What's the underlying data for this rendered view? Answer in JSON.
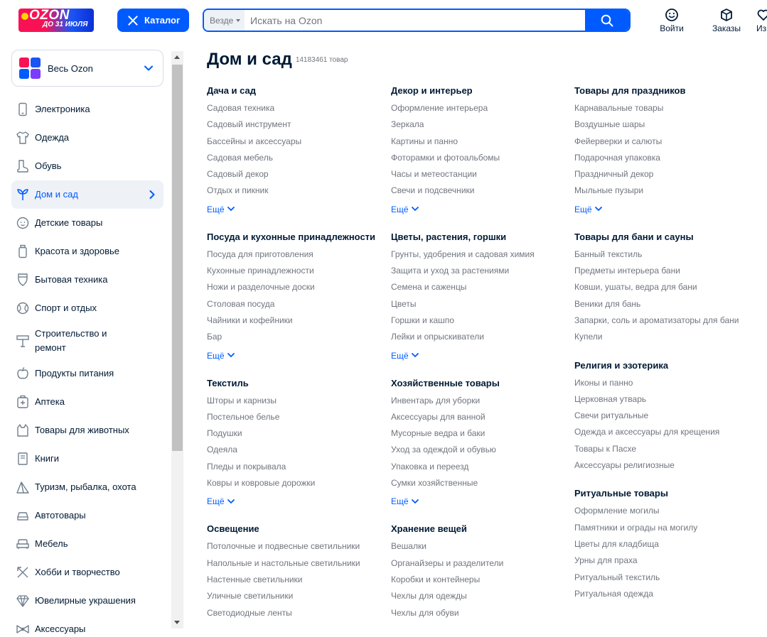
{
  "header": {
    "logo_main": "OZON",
    "logo_sub": "ДО 31 ИЮЛЯ",
    "catalog_label": "Каталог",
    "search_scope": "Везде",
    "search_placeholder": "Искать на Ozon",
    "login_label": "Войти",
    "orders_label": "Заказы",
    "favorites_label": "Из"
  },
  "sidebar": {
    "all_label": "Весь Ozon",
    "items": [
      {
        "label": "Электроника",
        "icon": "phone-icon"
      },
      {
        "label": "Одежда",
        "icon": "shirt-icon"
      },
      {
        "label": "Обувь",
        "icon": "boot-icon"
      },
      {
        "label": "Дом и сад",
        "icon": "plant-icon",
        "active": true
      },
      {
        "label": "Детские товары",
        "icon": "baby-icon"
      },
      {
        "label": "Красота и здоровье",
        "icon": "bottle-icon"
      },
      {
        "label": "Бытовая техника",
        "icon": "appliance-icon"
      },
      {
        "label": "Спорт и отдых",
        "icon": "ball-icon"
      },
      {
        "label": "Строительство и ремонт",
        "icon": "tools-icon",
        "tall": true
      },
      {
        "label": "Продукты питания",
        "icon": "apple-icon"
      },
      {
        "label": "Аптека",
        "icon": "pharmacy-icon"
      },
      {
        "label": "Товары для животных",
        "icon": "cat-icon"
      },
      {
        "label": "Книги",
        "icon": "book-icon"
      },
      {
        "label": "Туризм, рыбалка, охота",
        "icon": "tent-icon"
      },
      {
        "label": "Автотовары",
        "icon": "car-icon"
      },
      {
        "label": "Мебель",
        "icon": "sofa-icon"
      },
      {
        "label": "Хобби и творчество",
        "icon": "brush-icon"
      },
      {
        "label": "Ювелирные украшения",
        "icon": "diamond-icon"
      },
      {
        "label": "Аксессуары",
        "icon": "bow-icon"
      }
    ]
  },
  "main": {
    "title": "Дом и сад",
    "count": "14183461 товар",
    "more_label": "Ещё",
    "columns": [
      [
        {
          "title": "Дача и сад",
          "items": [
            "Садовая техника",
            "Садовый инструмент",
            "Бассейны и аксессуары",
            "Садовая мебель",
            "Садовый декор",
            "Отдых и пикник"
          ],
          "more": true
        },
        {
          "title": "Посуда и кухонные принадлежности",
          "items": [
            "Посуда для приготовления",
            "Кухонные принадлежности",
            "Ножи и разделочные доски",
            "Столовая посуда",
            "Чайники и кофейники",
            "Бар"
          ],
          "more": true
        },
        {
          "title": "Текстиль",
          "items": [
            "Шторы и карнизы",
            "Постельное белье",
            "Подушки",
            "Одеяла",
            "Пледы и покрывала",
            "Ковры и ковровые дорожки"
          ],
          "more": true
        },
        {
          "title": "Освещение",
          "items": [
            "Потолочные и подвесные светильники",
            "Напольные и настольные светильники",
            "Настенные светильники",
            "Уличные светильники",
            "Светодиодные ленты"
          ],
          "more": false
        }
      ],
      [
        {
          "title": "Декор и интерьер",
          "items": [
            "Оформление интерьера",
            "Зеркала",
            "Картины и панно",
            "Фоторамки и фотоальбомы",
            "Часы и метеостанции",
            "Свечи и подсвечники"
          ],
          "more": true
        },
        {
          "title": "Цветы, растения, горшки",
          "items": [
            "Грунты, удобрения и садовая химия",
            "Защита и уход за растениями",
            "Семена и саженцы",
            "Цветы",
            "Горшки и кашпо",
            "Лейки и опрыскиватели"
          ],
          "more": true
        },
        {
          "title": "Хозяйственные товары",
          "items": [
            "Инвентарь для уборки",
            "Аксессуары для ванной",
            "Мусорные ведра и баки",
            "Уход за одеждой и обувью",
            "Упаковка и переезд",
            "Сумки хозяйственные"
          ],
          "more": true
        },
        {
          "title": "Хранение вещей",
          "items": [
            "Вешалки",
            "Органайзеры и разделители",
            "Коробки и контейнеры",
            "Чехлы для одежды",
            "Чехлы для обуви"
          ],
          "more": false
        }
      ],
      [
        {
          "title": "Товары для праздников",
          "items": [
            "Карнавальные товары",
            "Воздушные шары",
            "Фейерверки и салюты",
            "Подарочная упаковка",
            "Праздничный декор",
            "Мыльные пузыри"
          ],
          "more": true
        },
        {
          "title": "Товары для бани и сауны",
          "items": [
            "Банный текстиль",
            "Предметы интерьера бани",
            "Ковши, ушаты, ведра для бани",
            "Веники для бань",
            "Запарки, соль и ароматизаторы для бани",
            "Купели"
          ],
          "more": false
        },
        {
          "title": "Религия и эзотерика",
          "items": [
            "Иконы и панно",
            "Церковная утварь",
            "Свечи ритуальные",
            "Одежда и аксессуары для крещения",
            "Товары к Пасхе",
            "Аксессуары религиозные"
          ],
          "more": false
        },
        {
          "title": "Ритуальные товары",
          "items": [
            "Оформление могилы",
            "Памятники и ограды на могилу",
            "Цветы для кладбища",
            "Урны для праха",
            "Ритуальный текстиль",
            "Ритуальная одежда"
          ],
          "more": false
        }
      ]
    ]
  },
  "colors": {
    "accent": "#005bff",
    "brand_pink": "#f91155",
    "text": "#001a34",
    "muted": "#70757d"
  }
}
